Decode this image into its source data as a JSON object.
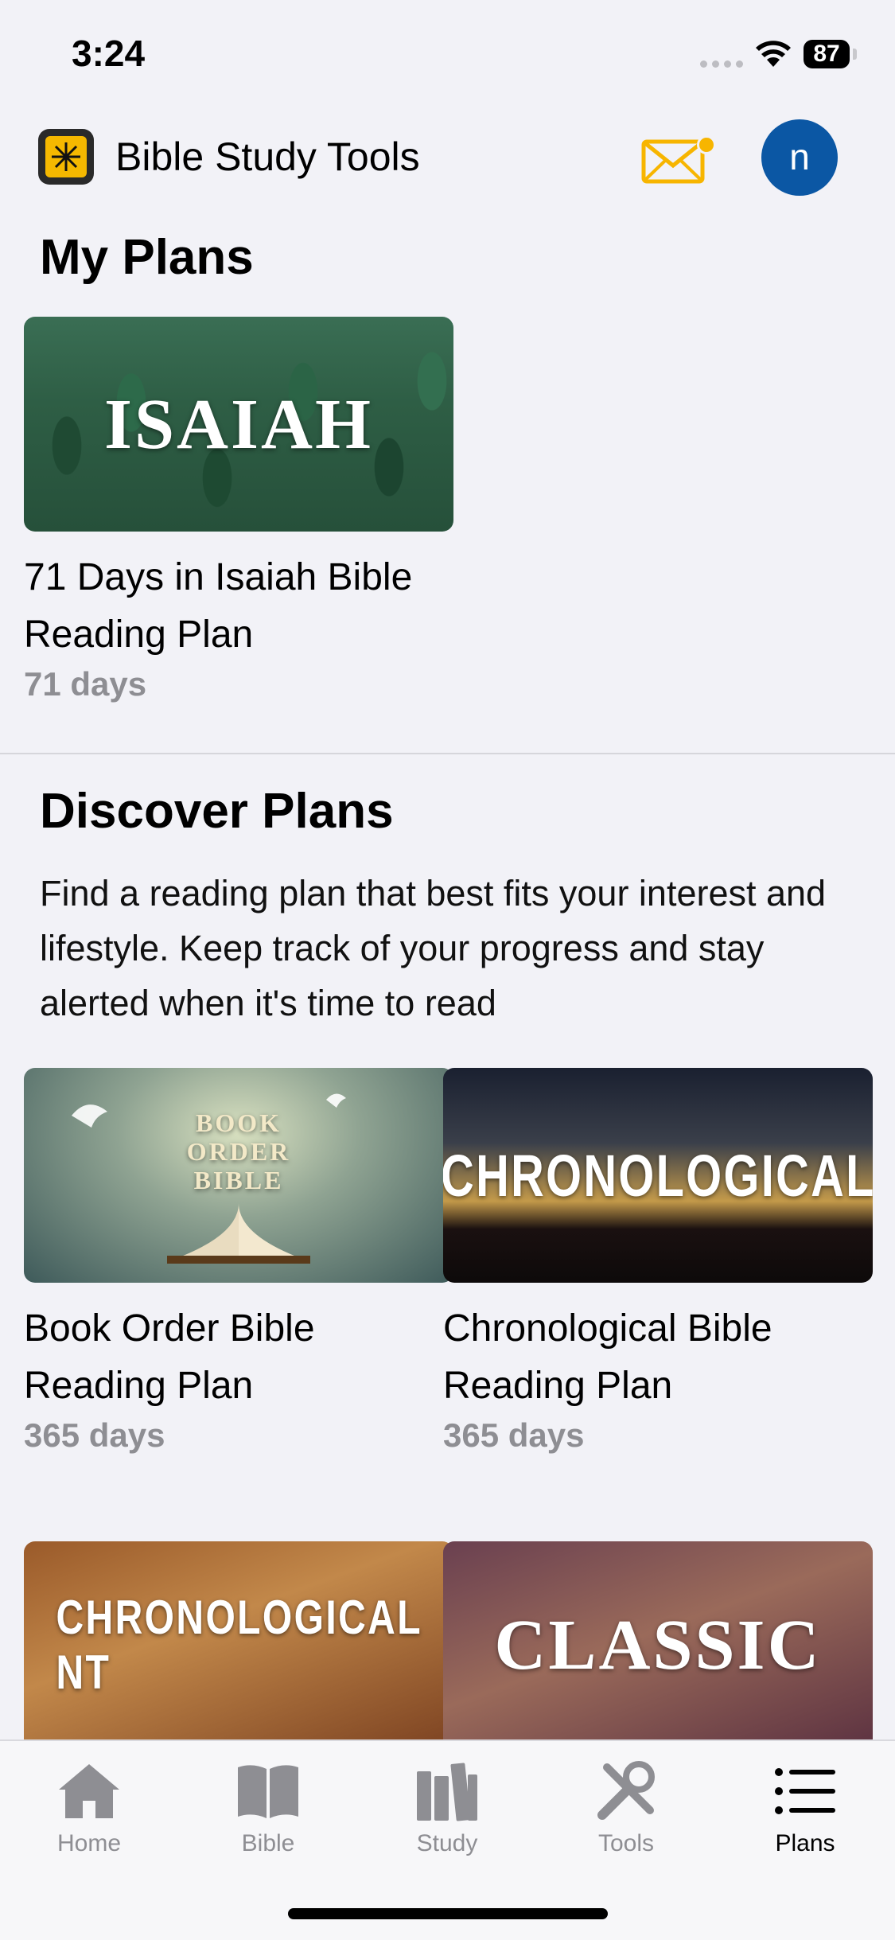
{
  "status_bar": {
    "time": "3:24",
    "battery": "87"
  },
  "header": {
    "app_title": "Bible Study Tools",
    "avatar_initial": "n"
  },
  "my_plans": {
    "title": "My Plans",
    "items": [
      {
        "image_text": "ISAIAH",
        "name": "71 Days in Isaiah Bible Reading Plan",
        "days": "71 days"
      }
    ]
  },
  "discover": {
    "title": "Discover Plans",
    "description": "Find a reading plan that best fits your interest and lifestyle. Keep track of your progress and stay alerted when it's time to read",
    "items": [
      {
        "image_text": "BOOK ORDER BIBLE",
        "name": "Book Order Bible Reading Plan",
        "days": "365 days"
      },
      {
        "image_text": "CHRONOLOGICAL",
        "name": "Chronological Bible Reading Plan",
        "days": "365 days"
      },
      {
        "image_text": "CHRONOLOGICAL NT",
        "name": "",
        "days": ""
      },
      {
        "image_text": "CLASSIC",
        "name": "",
        "days": ""
      }
    ]
  },
  "tab_bar": {
    "tabs": [
      {
        "label": "Home",
        "icon": "home-icon"
      },
      {
        "label": "Bible",
        "icon": "book-icon"
      },
      {
        "label": "Study",
        "icon": "books-icon"
      },
      {
        "label": "Tools",
        "icon": "tools-icon"
      },
      {
        "label": "Plans",
        "icon": "list-icon",
        "active": true
      }
    ]
  },
  "colors": {
    "accent_yellow": "#f7b500",
    "avatar_blue": "#0b57a4",
    "background": "#f2f2f7"
  }
}
